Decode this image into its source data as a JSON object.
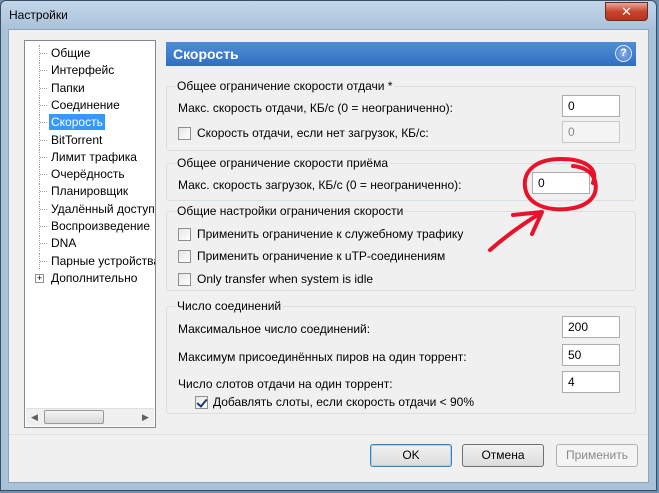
{
  "window": {
    "title": "Настройки",
    "close_label": "✕"
  },
  "tree": {
    "items": [
      {
        "label": "Общие"
      },
      {
        "label": "Интерфейс"
      },
      {
        "label": "Папки"
      },
      {
        "label": "Соединение"
      },
      {
        "label": "Скорость",
        "selected": true
      },
      {
        "label": "BitTorrent"
      },
      {
        "label": "Лимит трафика"
      },
      {
        "label": "Очерёдность"
      },
      {
        "label": "Планировщик"
      },
      {
        "label": "Удалённый доступ"
      },
      {
        "label": "Воспроизведение"
      },
      {
        "label": "DNA"
      },
      {
        "label": "Парные устройства"
      },
      {
        "label": "Дополнительно",
        "expander": "+"
      }
    ]
  },
  "header": {
    "title": "Скорость",
    "help_label": "?"
  },
  "upload_group": {
    "title": "Общее ограничение скорости отдачи *",
    "max_label": "Макс. скорость отдачи, КБ/с (0 = неограниченно):",
    "max_value": "0",
    "idle_label": "Скорость отдачи, если нет загрузок, КБ/с:",
    "idle_checked": false,
    "idle_value": "0"
  },
  "download_group": {
    "title": "Общее ограничение скорости приёма",
    "max_label": "Макс. скорость загрузок, КБ/с (0 = неограниченно):",
    "max_value": "0"
  },
  "general_group": {
    "title": "Общие настройки ограничения скорости",
    "options": [
      {
        "label": "Применить ограничение к служебному трафику",
        "checked": false
      },
      {
        "label": "Применить ограничение к uTP-соединениям",
        "checked": false
      },
      {
        "label": "Only transfer when system is idle",
        "checked": false
      }
    ]
  },
  "connections_group": {
    "title": "Число соединений",
    "max_connections_label": "Максимальное число соединений:",
    "max_connections_value": "200",
    "peers_label": "Максимум присоединённых пиров на один торрент:",
    "peers_value": "50",
    "slots_label": "Число слотов отдачи на один торрент:",
    "slots_value": "4",
    "extra_slots_label": "Добавлять слоты, если скорость отдачи < 90%",
    "extra_slots_checked": true
  },
  "buttons": {
    "ok": "OK",
    "cancel": "Отмена",
    "apply": "Применить"
  },
  "annotation_color": "#e8132b"
}
